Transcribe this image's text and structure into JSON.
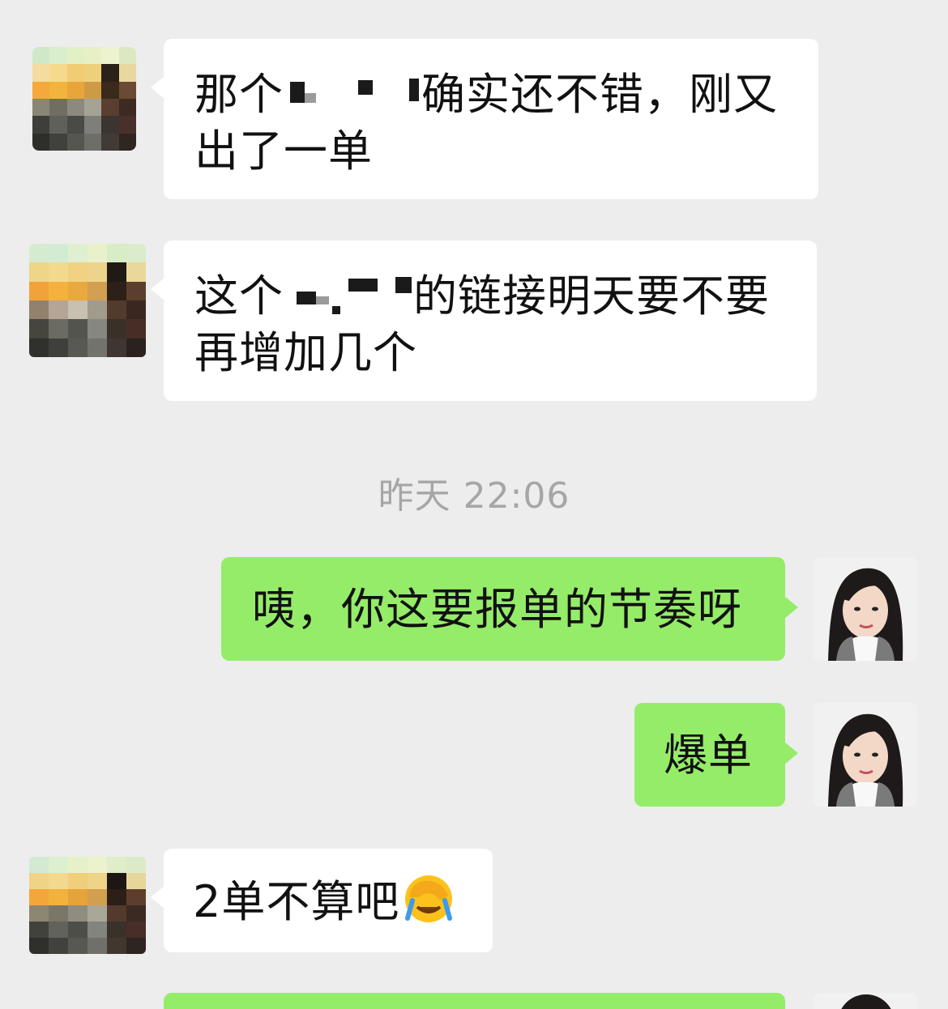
{
  "messages": [
    {
      "line1_pre": "那个",
      "line1_post": "确实还不错，刚又",
      "line2": "出了一单"
    },
    {
      "line1_pre": "这个",
      "line1_post": "的链接明天要不要",
      "line2": "再增加几个"
    },
    {
      "timestamp": "昨天 22:06"
    },
    {
      "text": "咦，你这要报单的节奏呀"
    },
    {
      "text": "爆单"
    },
    {
      "text": "2单不算吧",
      "emoji": "face-with-hand-over-eyes-crying-emoji"
    }
  ],
  "colors": {
    "background": "#ededed",
    "incoming_bubble": "#ffffff",
    "outgoing_bubble": "#95ec69",
    "timestamp": "#a6a6a6"
  }
}
